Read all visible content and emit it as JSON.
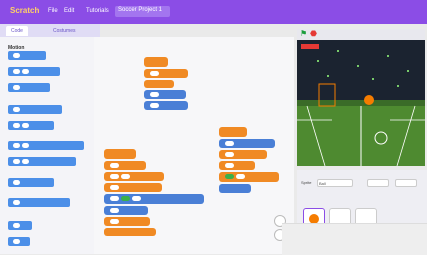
{
  "topbar": {
    "logo": "Scratch",
    "menus": [
      "File",
      "Edit",
      "Tutorials"
    ],
    "project": "Soccer Project 1"
  },
  "tabs": {
    "code": "Code",
    "costumes": "Costumes"
  },
  "palette": {
    "category": "Motion"
  },
  "sprite_panel": {
    "sprite_label": "Sprite",
    "sprite_name": "Ball"
  },
  "stage": {
    "score_text": "Score: 0"
  },
  "colors": {
    "accent": "#8b4de6",
    "events": "#f08a24",
    "motion": "#4a7fd6",
    "operators": "#3cb04a"
  }
}
